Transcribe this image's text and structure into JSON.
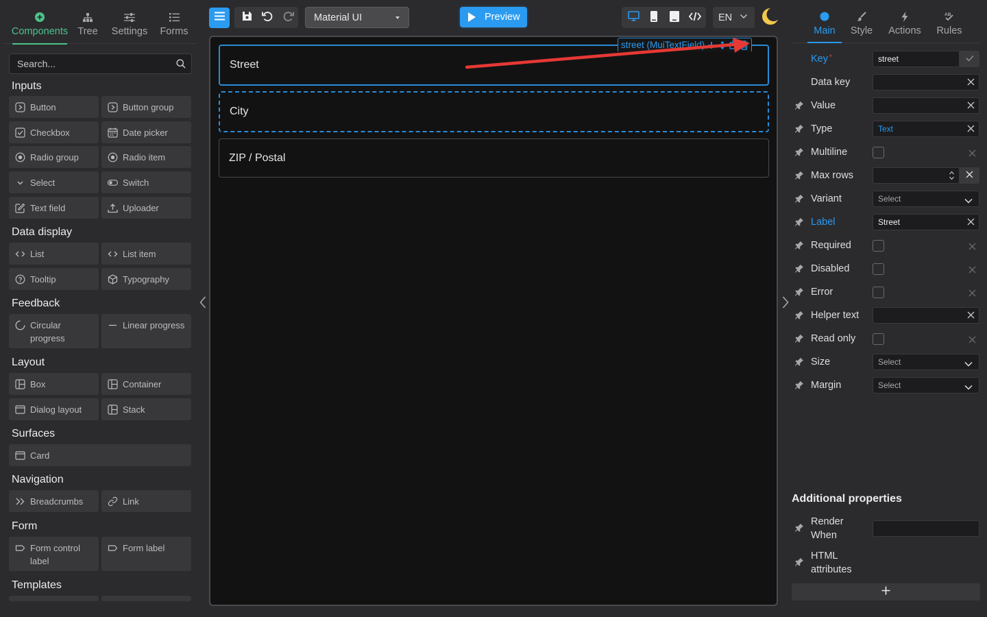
{
  "left_tabs": [
    {
      "label": "Components",
      "icon": "plus-circle-icon"
    },
    {
      "label": "Tree",
      "icon": "hierarchy-icon"
    },
    {
      "label": "Settings",
      "icon": "sliders-icon"
    },
    {
      "label": "Forms",
      "icon": "list-icon"
    }
  ],
  "search": {
    "placeholder": "Search..."
  },
  "sections": {
    "inputs": "Inputs",
    "data_display": "Data display",
    "feedback": "Feedback",
    "layout": "Layout",
    "surfaces": "Surfaces",
    "navigation": "Navigation",
    "form": "Form",
    "templates": "Templates"
  },
  "components": {
    "button": "Button",
    "button_group": "Button group",
    "checkbox": "Checkbox",
    "date_picker": "Date picker",
    "radio_group": "Radio group",
    "radio_item": "Radio item",
    "select": "Select",
    "switch": "Switch",
    "text_field": "Text field",
    "uploader": "Uploader",
    "list": "List",
    "list_item": "List item",
    "tooltip": "Tooltip",
    "typography": "Typography",
    "circular_progress_1": "Circular",
    "circular_progress_2": "progress",
    "linear_progress": "Linear progress",
    "box": "Box",
    "container": "Container",
    "dialog_layout": "Dialog layout",
    "stack": "Stack",
    "card": "Card",
    "breadcrumbs": "Breadcrumbs",
    "link": "Link",
    "form_control_label_1": "Form control",
    "form_control_label_2": "label",
    "form_label": "Form label"
  },
  "toolbar": {
    "library": "Material UI",
    "preview": "Preview",
    "language": "EN"
  },
  "canvas": {
    "selection_label": "street (MuiTextField)",
    "fields": [
      "Street",
      "City",
      "ZIP / Postal"
    ]
  },
  "right_tabs": [
    {
      "label": "Main",
      "icon": "circle-icon"
    },
    {
      "label": "Style",
      "icon": "brush-icon"
    },
    {
      "label": "Actions",
      "icon": "bolt-icon"
    },
    {
      "label": "Rules",
      "icon": "rules-icon"
    }
  ],
  "properties": {
    "key": {
      "label": "Key",
      "value": "street"
    },
    "data_key": {
      "label": "Data key",
      "value": ""
    },
    "value": {
      "label": "Value",
      "value": ""
    },
    "type": {
      "label": "Type",
      "value": "Text"
    },
    "multiline": {
      "label": "Multiline"
    },
    "max_rows": {
      "label": "Max rows",
      "value": ""
    },
    "variant": {
      "label": "Variant",
      "value": "Select"
    },
    "label": {
      "label": "Label",
      "value": "Street"
    },
    "required": {
      "label": "Required"
    },
    "disabled": {
      "label": "Disabled"
    },
    "error": {
      "label": "Error"
    },
    "helper_text": {
      "label": "Helper text",
      "value": ""
    },
    "read_only": {
      "label": "Read only"
    },
    "size": {
      "label": "Size",
      "value": "Select"
    },
    "margin": {
      "label": "Margin",
      "value": "Select"
    }
  },
  "additional": {
    "title": "Additional properties",
    "render_when_1": "Render",
    "render_when_2": "When",
    "html_attributes_1": "HTML",
    "html_attributes_2": "attributes"
  },
  "colors": {
    "accent_blue": "#2a9bf0",
    "accent_green": "#4cc38a",
    "annotation_red": "#e53935"
  }
}
